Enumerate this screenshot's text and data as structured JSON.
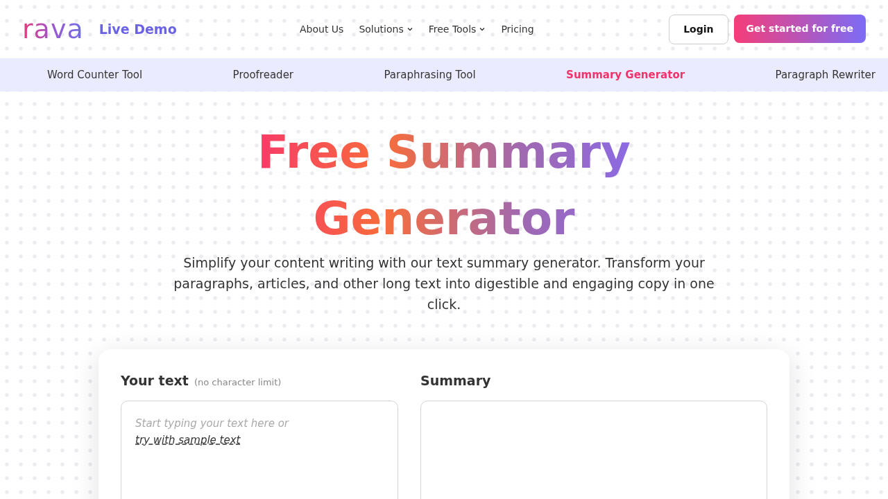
{
  "header": {
    "logo": "rava",
    "tagline": "Live Demo",
    "nav": [
      {
        "label": "About Us",
        "has_dropdown": false
      },
      {
        "label": "Solutions",
        "has_dropdown": true
      },
      {
        "label": "Free Tools",
        "has_dropdown": true
      },
      {
        "label": "Pricing",
        "has_dropdown": false
      }
    ],
    "login": "Login",
    "cta": "Get started for free"
  },
  "tool_tabs": [
    {
      "label": "Word Counter Tool",
      "selected": false
    },
    {
      "label": "Proofreader",
      "selected": false
    },
    {
      "label": "Paraphrasing Tool",
      "selected": false
    },
    {
      "label": "Summary Generator",
      "selected": true
    },
    {
      "label": "Paragraph Rewriter",
      "selected": false
    }
  ],
  "hero": {
    "title": "Free Summary Generator",
    "subtitle": "Simplify your content writing with our text summary generator. Transform your paragraphs, articles, and other long text into digestible and engaging copy in one click."
  },
  "editor": {
    "input_title": "Your text",
    "input_note": "(no character limit)",
    "placeholder": "Start typing your text here or",
    "sample_link": "try with sample text",
    "output_title": "Summary"
  }
}
